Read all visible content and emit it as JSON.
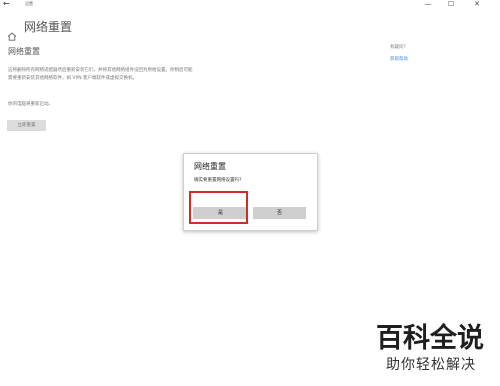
{
  "window": {
    "back_glyph": "←",
    "title": "设置",
    "minimize_glyph": "—",
    "maximize_glyph": "☐",
    "close_glyph": "✕"
  },
  "header": {
    "home_icon": "home-icon",
    "title": "网络重置"
  },
  "main": {
    "section_title": "网络重置",
    "description": "这将删除所有网络适配器然后重新安装它们，并将其他网络组件设回为原始设置。你稍后可能需要重新安装其他网络软件，如 VPN 客户端软件或虚拟交换机。",
    "restart_note": "你的电脑将重新启动。",
    "reset_button": "立即重置"
  },
  "help": {
    "question": "有疑问?",
    "link": "获取帮助"
  },
  "dialog": {
    "title": "网络重置",
    "question": "确实要重置网络设置吗?",
    "yes_button": "是",
    "no_button": "否"
  },
  "annotation": {
    "highlight_color": "#d42a2a"
  },
  "watermark": {
    "title": "百科全说",
    "subtitle": "助你轻松解决"
  }
}
